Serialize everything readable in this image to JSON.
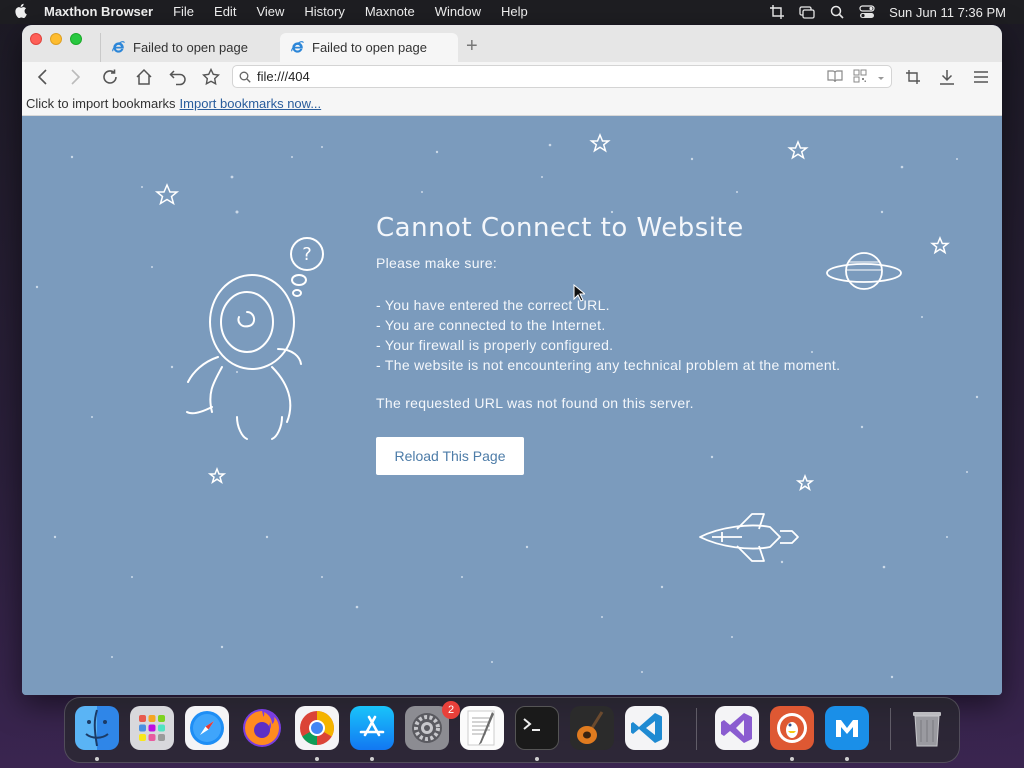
{
  "menubar": {
    "app_name": "Maxthon Browser",
    "items": [
      "File",
      "Edit",
      "View",
      "History",
      "Maxnote",
      "Window",
      "Help"
    ],
    "clock": "Sun Jun 11  7:36 PM"
  },
  "tabs": [
    {
      "label": "Failed to open page",
      "active": false
    },
    {
      "label": "Failed to open page",
      "active": true
    }
  ],
  "address_bar": {
    "url": "file:///404"
  },
  "bookmark_bar": {
    "prompt": "Click to import bookmarks",
    "link": "Import bookmarks now..."
  },
  "error_page": {
    "title": "Cannot Connect to Website",
    "intro": "Please make sure:",
    "checks": [
      "- You have entered the correct URL.",
      "- You are connected to the Internet.",
      "- Your firewall is properly configured.",
      "- The website is not encountering any technical problem at the moment."
    ],
    "not_found": "The requested URL was not found on this server.",
    "reload_label": "Reload This Page"
  },
  "dock": {
    "apps": [
      "finder-icon",
      "launchpad-icon",
      "safari-icon",
      "firefox-icon",
      "chrome-icon",
      "app-store-icon",
      "system-settings-icon",
      "textedit-icon",
      "terminal-icon",
      "garageband-icon",
      "vscode-icon",
      "visual-studio-icon",
      "duckduckgo-icon",
      "maxthon-icon",
      "trash-icon"
    ],
    "settings_badge": "2"
  },
  "colors": {
    "page_background": "#7b9bbd",
    "reload_text": "#4d7ca8",
    "link": "#2a5d9c"
  }
}
